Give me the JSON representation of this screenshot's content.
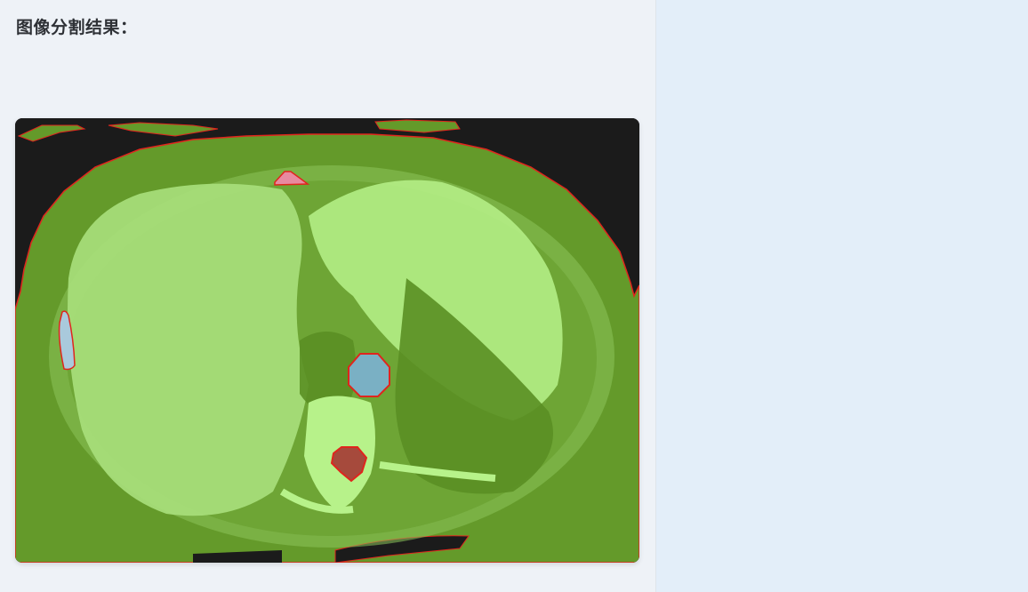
{
  "result": {
    "title": "图像分割结果："
  },
  "segmentation": {
    "colors": {
      "background_region": "#649a2a",
      "tissue_light": "#b7f28a",
      "tissue_mid": "#8cc45a",
      "outline": "#e0251d",
      "dark_bg": "#1b1b1b",
      "vessel": "#7ab0c4",
      "kidney_left": "#a9c9dc",
      "small_region_top": "#e88aa0",
      "spinal_region": "#a64a3c"
    }
  }
}
